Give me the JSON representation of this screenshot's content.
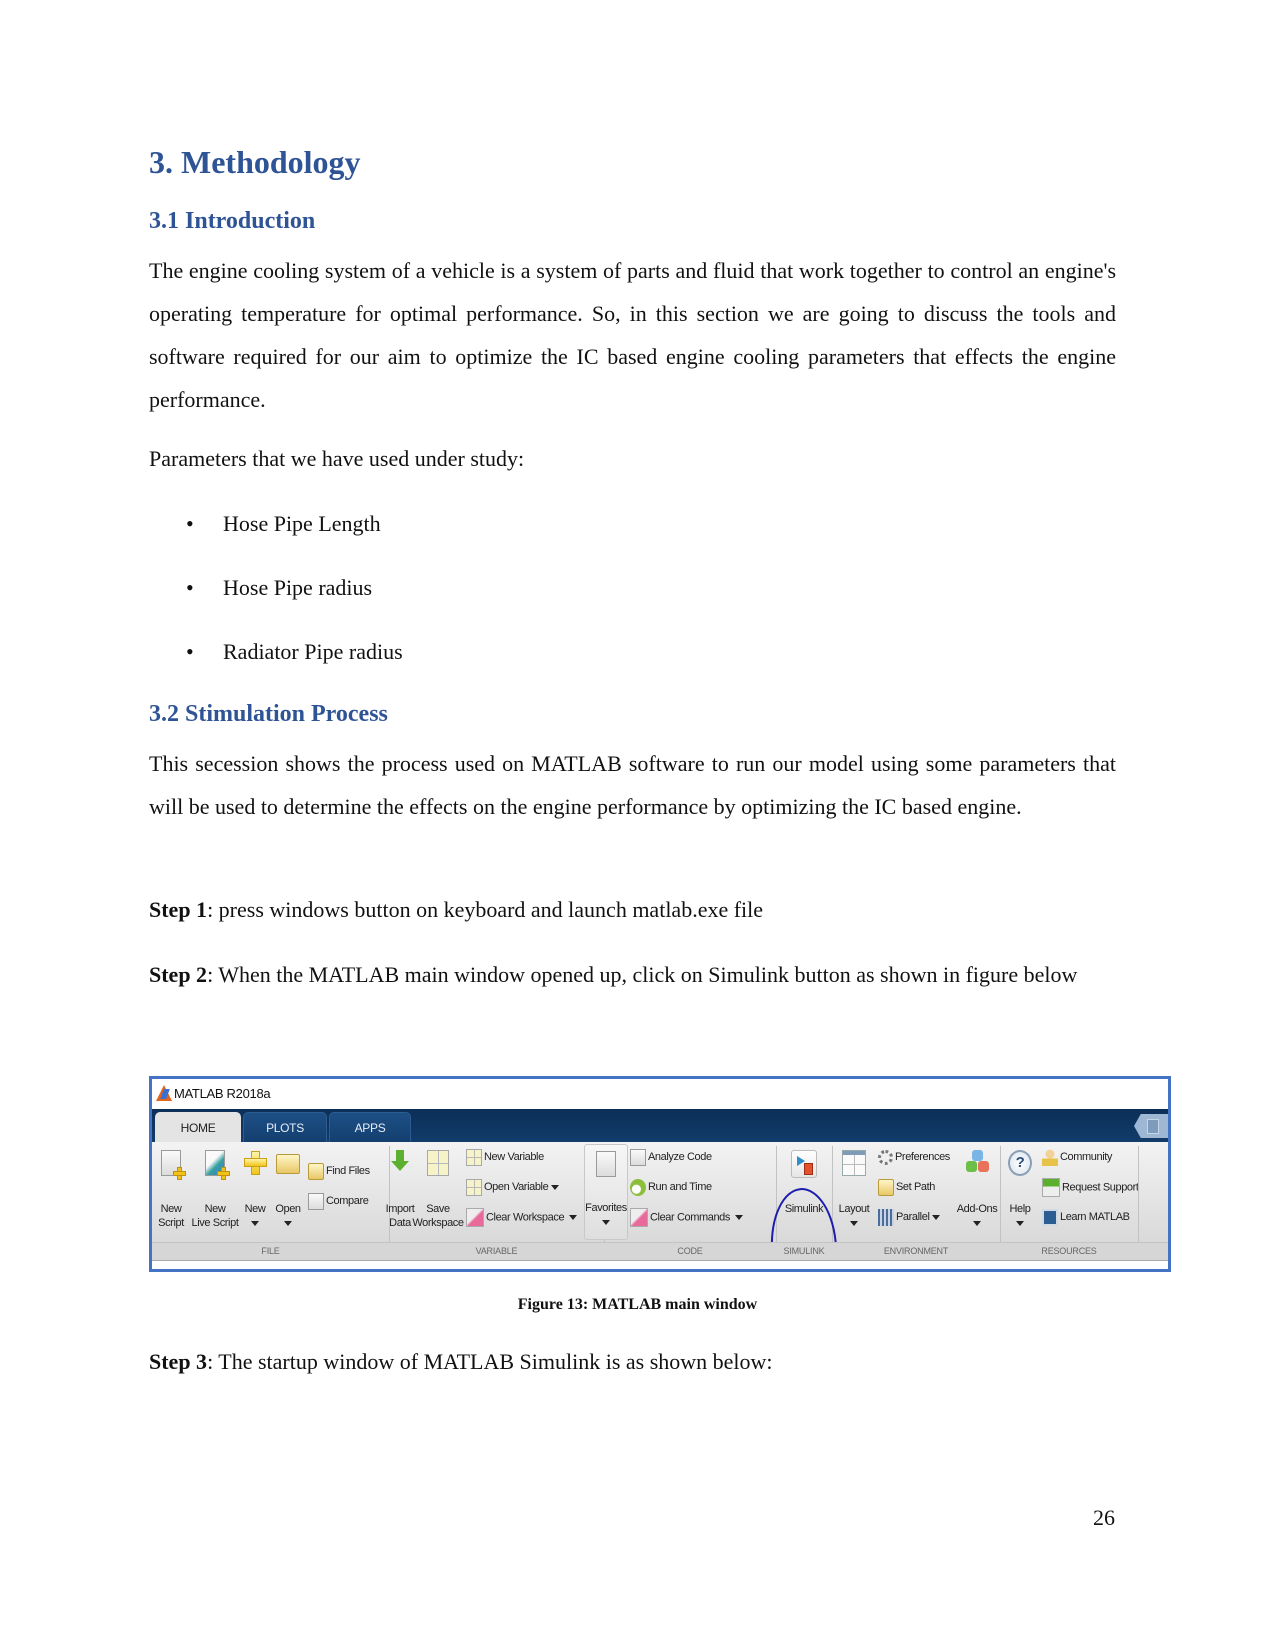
{
  "document": {
    "heading_main": "3. Methodology",
    "section_intro": {
      "heading": "3.1 Introduction",
      "paragraph": "The engine cooling system of a vehicle is a system of parts and fluid that work together to control an engine's operating temperature for optimal performance. So, in this section we are going to discuss the tools and software required for our aim to optimize the IC based engine cooling parameters that effects the engine performance.",
      "params_intro": "Parameters that we have used under study:",
      "bullet_symbol": "•",
      "parameters": [
        "Hose Pipe Length",
        "Hose Pipe radius",
        "Radiator Pipe radius"
      ]
    },
    "section_process": {
      "heading": "3.2 Stimulation Process",
      "paragraph": "This secession shows the process used on MATLAB software to run our model using some parameters that will be used to determine the effects on the engine performance by optimizing the IC based engine.",
      "steps": [
        {
          "label": "Step 1",
          "text": ": press windows button on keyboard and launch matlab.exe file"
        },
        {
          "label": "Step 2",
          "text": ": When the MATLAB main window opened up, click on Simulink button as shown in figure below"
        },
        {
          "label": "Step 3",
          "text": ": The startup window of MATLAB Simulink is as shown below:"
        }
      ]
    },
    "figure_caption": "Figure 13: MATLAB main window",
    "page_number": "26",
    "heading_color": "#2F5496",
    "figure_border_color": "#4472C4",
    "annotation_color": "#1C1CAE"
  },
  "matlab": {
    "window_title": "MATLAB R2018a",
    "tabs": [
      {
        "label": "HOME",
        "active": true
      },
      {
        "label": "PLOTS",
        "active": false
      },
      {
        "label": "APPS",
        "active": false
      }
    ],
    "sections": {
      "file": {
        "label": "FILE",
        "new_script": [
          "New",
          "Script"
        ],
        "new_live_script": [
          "New",
          "Live Script"
        ],
        "new": "New",
        "open": "Open",
        "find_files": "Find Files",
        "compare": "Compare"
      },
      "variable": {
        "label": "VARIABLE",
        "import_data": [
          "Import",
          "Data"
        ],
        "save_workspace": [
          "Save",
          "Workspace"
        ],
        "new_variable": "New Variable",
        "open_variable": "Open Variable",
        "clear_workspace": "Clear Workspace"
      },
      "code": {
        "label": "CODE",
        "favorites": "Favorites",
        "analyze_code": "Analyze Code",
        "run_and_time": "Run and Time",
        "clear_commands": "Clear Commands"
      },
      "simulink": {
        "label": "SIMULINK",
        "simulink": "Simulink"
      },
      "environment": {
        "label": "ENVIRONMENT",
        "layout": "Layout",
        "preferences": "Preferences",
        "set_path": "Set Path",
        "parallel": "Parallel",
        "add_ons": "Add-Ons"
      },
      "resources": {
        "label": "RESOURCES",
        "help": "Help",
        "community": "Community",
        "request_support": "Request Support",
        "learn_matlab": "Learn MATLAB"
      }
    }
  }
}
